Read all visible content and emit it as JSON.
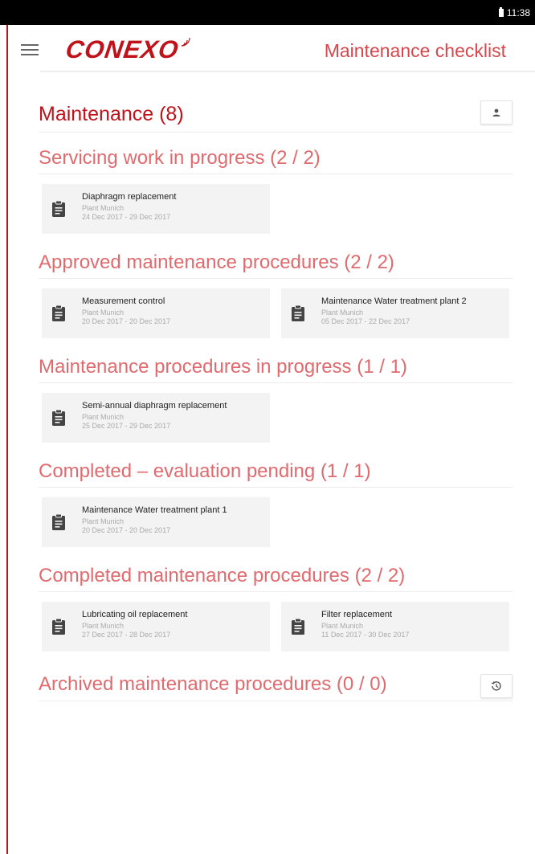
{
  "status_bar": {
    "time": "11:38"
  },
  "header": {
    "logo_text": "CONEXO",
    "title": "Maintenance checklist"
  },
  "page": {
    "title": "Maintenance (8)"
  },
  "sections": [
    {
      "title": "Servicing work in progress (2 / 2)",
      "cards": [
        {
          "title": "Diaphragm replacement",
          "plant": "Plant Munich",
          "dates": "24 Dec 2017 - 29 Dec 2017"
        }
      ]
    },
    {
      "title": "Approved maintenance procedures (2 / 2)",
      "cards": [
        {
          "title": "Measurement control",
          "plant": "Plant Munich",
          "dates": "20 Dec 2017 - 20 Dec 2017"
        },
        {
          "title": "Maintenance Water treatment plant 2",
          "plant": "Plant Munich",
          "dates": "05 Dec 2017 - 22 Dec 2017"
        }
      ]
    },
    {
      "title": "Maintenance procedures in progress (1 / 1)",
      "cards": [
        {
          "title": "Semi-annual diaphragm replacement",
          "plant": "Plant Munich",
          "dates": "25 Dec 2017 - 29 Dec 2017"
        }
      ]
    },
    {
      "title": "Completed – evaluation pending (1 / 1)",
      "cards": [
        {
          "title": "Maintenance Water treatment plant 1",
          "plant": "Plant Munich",
          "dates": "20 Dec 2017 - 20 Dec 2017"
        }
      ]
    },
    {
      "title": "Completed maintenance procedures (2 / 2)",
      "cards": [
        {
          "title": "Lubricating oil replacement",
          "plant": "Plant Munich",
          "dates": "27 Dec 2017 - 28 Dec 2017"
        },
        {
          "title": "Filter replacement",
          "plant": "Plant Munich",
          "dates": "11 Dec 2017 - 30 Dec 2017"
        }
      ]
    },
    {
      "title": "Archived maintenance procedures (0 / 0)",
      "cards": []
    }
  ],
  "colors": {
    "brand_red": "#c0121a",
    "section_red": "#e06a6e",
    "card_bg": "#f3f3f3"
  },
  "icons": {
    "menu": "hamburger-menu-icon",
    "user": "person-icon",
    "card": "clipboard-icon",
    "history": "history-icon",
    "logo_signal": "signal-waves-icon"
  }
}
